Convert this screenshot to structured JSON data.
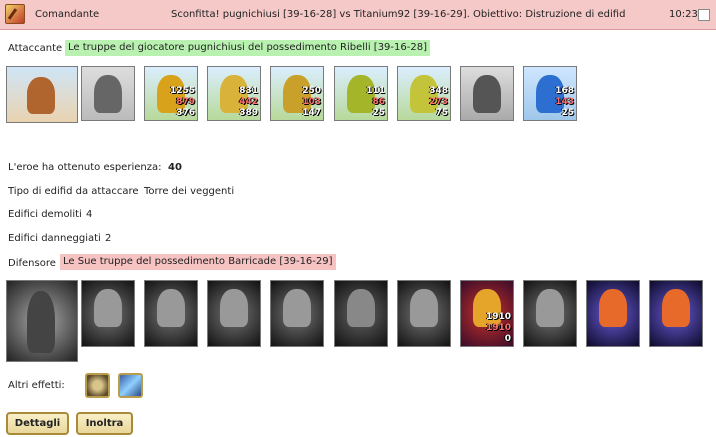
{
  "header": {
    "category": "Comandante",
    "subject": "Sconfitta! pugnichiusi [39-16-28] vs Titanium92 [39-16-29]. Obiettivo: Distruzione di edifid",
    "time": "10:23",
    "icon": "crossed-swords-icon"
  },
  "attacker": {
    "label": "Attaccante",
    "title": "Le truppe del giocatore pugnichiusi del possedimento Ribelli [39-16-28]",
    "color": "#b9f2b0",
    "units": [
      {
        "name": "hero-portrait",
        "counts": []
      },
      {
        "name": "unit-1",
        "counts": []
      },
      {
        "name": "unit-2",
        "counts": [
          "1255",
          "879",
          "376"
        ]
      },
      {
        "name": "unit-3",
        "counts": [
          "831",
          "442",
          "389"
        ]
      },
      {
        "name": "unit-4",
        "counts": [
          "250",
          "103",
          "147"
        ]
      },
      {
        "name": "unit-5",
        "counts": [
          "111",
          "86",
          "25"
        ]
      },
      {
        "name": "unit-6",
        "counts": [
          "348",
          "273",
          "75"
        ]
      },
      {
        "name": "unit-7",
        "counts": []
      },
      {
        "name": "unit-8",
        "counts": [
          "168",
          "143",
          "25"
        ]
      }
    ]
  },
  "details": {
    "xp_label": "L'eroe ha ottenuto esperienza:",
    "xp_value": "40",
    "building_label": "Tipo di edifid da attaccare",
    "building_value": "Torre dei veggenti",
    "demolished_label": "Edifici demoliti",
    "demolished_value": "4",
    "damaged_label": "Edifici danneggiati",
    "damaged_value": "2"
  },
  "defender": {
    "label": "Difensore",
    "title": "Le Sue truppe del possedimento Barricade [39-16-29]",
    "color": "#f6c2c2",
    "units": [
      {
        "name": "defender-portrait",
        "counts": []
      },
      {
        "name": "d-unit-1",
        "counts": []
      },
      {
        "name": "d-unit-2",
        "counts": []
      },
      {
        "name": "d-unit-3",
        "counts": []
      },
      {
        "name": "d-unit-4",
        "counts": []
      },
      {
        "name": "d-unit-5",
        "counts": []
      },
      {
        "name": "d-unit-6",
        "counts": []
      },
      {
        "name": "d-unit-7",
        "counts": [
          "1910",
          "1910",
          "0"
        ]
      },
      {
        "name": "d-unit-8",
        "counts": []
      },
      {
        "name": "d-unit-9",
        "counts": []
      },
      {
        "name": "d-unit-10",
        "counts": []
      }
    ]
  },
  "effects": {
    "label": "Altri effetti:",
    "icons": [
      "gear-effect-icon",
      "sword-effect-icon"
    ]
  },
  "buttons": {
    "details": "Dettagli",
    "forward": "Inoltra"
  }
}
